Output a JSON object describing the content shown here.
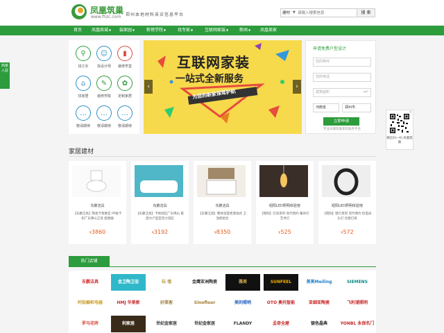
{
  "header": {
    "logo_cn": "凤凰筑巢",
    "logo_url": "www.fhzc.com",
    "slogan": "郑州本地材料采买信息平台",
    "search_type": "建材",
    "search_placeholder": "请输入搜索信息",
    "search_button": "搜 索"
  },
  "nav": [
    "首页",
    "凤凰商城",
    "装家园",
    "新榜学院",
    "找专家",
    "互联网家装",
    "新闻",
    "凤凰美家"
  ],
  "side_tab": "商家入驻",
  "quick": [
    {
      "label": "找工长",
      "icon": "search-worker-icon",
      "glyph": "⚲",
      "color": "#2c9c3c"
    },
    {
      "label": "找设计师",
      "icon": "designer-icon",
      "glyph": "☺",
      "color": "#2a8fc7"
    },
    {
      "label": "装修学堂",
      "icon": "paint-roller-icon",
      "glyph": "▮",
      "color": "#d94a3a"
    },
    {
      "label": "找家居",
      "icon": "home-icon",
      "glyph": "⌂",
      "color": "#2a8fc7"
    },
    {
      "label": "装修学院",
      "icon": "academy-icon",
      "glyph": "✎",
      "color": "#2c9c3c"
    },
    {
      "label": "定制家居",
      "icon": "custom-icon",
      "glyph": "✿",
      "color": "#2c9c3c"
    },
    {
      "label": "敬请期待",
      "icon": "coming-soon-icon",
      "glyph": "…",
      "color": "#2a8fc7"
    },
    {
      "label": "敬请期待",
      "icon": "coming-soon-icon",
      "glyph": "…",
      "color": "#2a8fc7"
    },
    {
      "label": "敬请期待",
      "icon": "coming-soon-icon",
      "glyph": "…",
      "color": "#2a8fc7"
    }
  ],
  "banner": {
    "title": "互联网家装",
    "subtitle": "一站式全新服务",
    "strip": "为您的新家保驾护航"
  },
  "form": {
    "title": "申请免费户型设计",
    "name_placeholder": "您的称呼",
    "phone_placeholder": "您的电话",
    "area_placeholder": "建筑面积",
    "area_unit": "m²",
    "province": "河南省",
    "city": "郑州市",
    "submit": "立即申请",
    "note": "专业凤凰筑巢家装服务平台"
  },
  "qr": {
    "close": "×",
    "text": "微信扫一扫 凤凰筑巢"
  },
  "section_title": "家居建材",
  "products": [
    {
      "brand": "东鹏洁具",
      "desc": "【东鹏洁具】陶瓷卡顿便宜 PP板卡扣广东佛山卫浴 座便器",
      "price": "3860",
      "kind": "toilet"
    },
    {
      "brand": "东鹏洁具",
      "desc": "【东鹏洁具】卡顿浴缸广东佛山 家庭大户型亚克力浴缸",
      "price": "3192",
      "kind": "bath"
    },
    {
      "brand": "东鹏洁具",
      "desc": "【东鹏洁具】整体浴室柜落地式 卫浴柜组合",
      "price": "8350",
      "kind": "cabinet"
    },
    {
      "brand": "昭阳LED照明体验馆",
      "desc": "【昭阳】灯具系列 现代简约 餐吊灯 艺术灯",
      "price": "525",
      "kind": "lamp1"
    },
    {
      "brand": "昭阳LED照明体验馆",
      "desc": "【昭阳】壁灯系列 现代简约 卧室床头灯 创意灯具",
      "price": "572",
      "kind": "lamp2"
    }
  ],
  "currency": "¥",
  "hot_tab": "热门店铺",
  "shops": [
    {
      "name": "东鹏洁具",
      "color": "#d32f2f",
      "bg": "#fff"
    },
    {
      "name": "金卫陶卫浴",
      "color": "#fff",
      "bg": "#2fb8c9"
    },
    {
      "name": "玩 墙",
      "color": "#b79a44",
      "bg": "#fff"
    },
    {
      "name": "金鹰亚洲陶瓷",
      "color": "#333",
      "bg": "#fff"
    },
    {
      "name": "雅美",
      "color": "#d4b04a",
      "bg": "#111"
    },
    {
      "name": "SUNFEEL",
      "color": "#f0b400",
      "bg": "#111"
    },
    {
      "name": "美美Meiling",
      "color": "#1a7dc7",
      "bg": "#fff"
    },
    {
      "name": "SIEMENS",
      "color": "#0a8a86",
      "bg": "#fff"
    },
    {
      "name": "阿铂橱柜电器",
      "color": "#caa02e",
      "bg": "#fff"
    },
    {
      "name": "HMJ 华美家",
      "color": "#c62828",
      "bg": "#fff"
    },
    {
      "name": "好莱客",
      "color": "#9c7c3c",
      "bg": "#fff"
    },
    {
      "name": "Sinofloor",
      "color": "#a37a2c",
      "bg": "#fff"
    },
    {
      "name": "美的照明",
      "color": "#1f5fbf",
      "bg": "#fff"
    },
    {
      "name": "OTO 奥托智能",
      "color": "#c62828",
      "bg": "#fff"
    },
    {
      "name": "亚细亚陶瓷",
      "color": "#c62828",
      "bg": "#fff"
    },
    {
      "name": "飞利浦照明",
      "color": "#c62828",
      "bg": "#fff"
    },
    {
      "name": "罗马花砖",
      "color": "#d94a3a",
      "bg": "#fff"
    },
    {
      "name": "利家居",
      "color": "#fff",
      "bg": "#3a2a1a"
    },
    {
      "name": "世纪金家居",
      "color": "#333",
      "bg": "#fff"
    },
    {
      "name": "世纪金家居",
      "color": "#333",
      "bg": "#fff"
    },
    {
      "name": "FLANDY",
      "color": "#333",
      "bg": "#fff"
    },
    {
      "name": "孟奇全屋",
      "color": "#c62828",
      "bg": "#fff"
    },
    {
      "name": "银色晶典",
      "color": "#222",
      "bg": "#fff"
    },
    {
      "name": "YONBL 永保名门",
      "color": "#c62828",
      "bg": "#fff"
    }
  ],
  "colors": {
    "brand_green": "#2c9c3c",
    "price_orange": "#e95b1d",
    "banner_yellow": "#f7d94c"
  }
}
